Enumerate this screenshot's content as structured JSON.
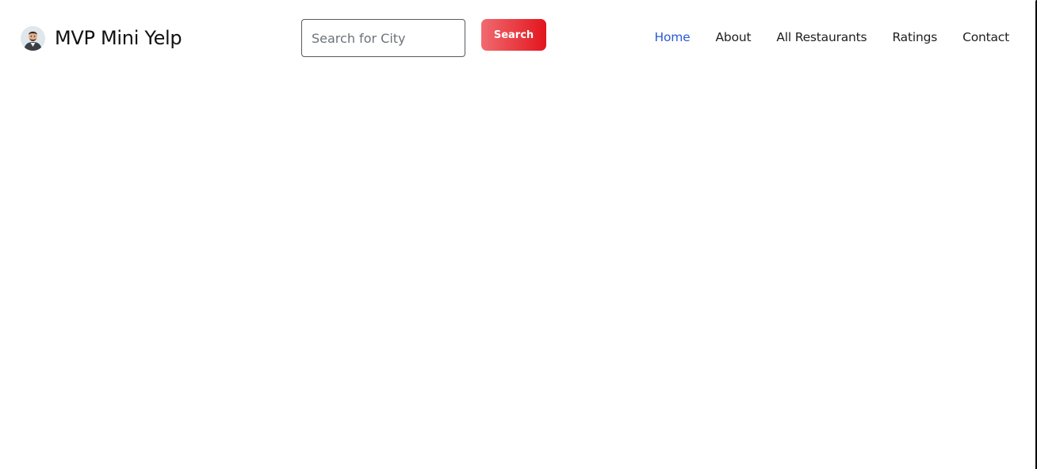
{
  "brand": {
    "name": "MVP Mini Yelp",
    "logo_icon": "avatar-icon"
  },
  "search": {
    "placeholder": "Search for City",
    "value": "",
    "button_label": "Search",
    "button_gradient": [
      "#f06a70",
      "#e3151d"
    ]
  },
  "nav": {
    "items": [
      {
        "label": "Home",
        "active": true
      },
      {
        "label": "About",
        "active": false
      },
      {
        "label": "All Restaurants",
        "active": false
      },
      {
        "label": "Ratings",
        "active": false
      },
      {
        "label": "Contact",
        "active": false
      }
    ],
    "active_color": "#2a5bd7",
    "text_color": "#1f1f1f"
  }
}
